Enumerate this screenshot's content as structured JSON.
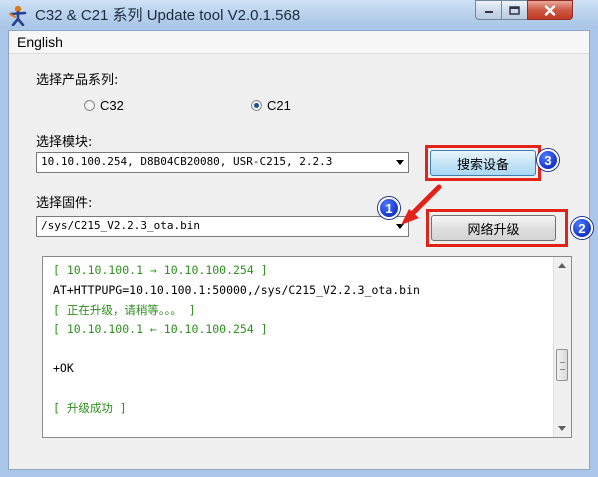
{
  "window": {
    "title": "C32 & C21 系列 Update tool V2.0.1.568",
    "icons": {
      "app": "app-person-icon",
      "minimize": "minimize-icon",
      "maximize": "maximize-icon",
      "close": "close-icon"
    }
  },
  "menubar": {
    "items": [
      "English"
    ]
  },
  "product": {
    "label": "选择产品系列:",
    "options": [
      {
        "label": "C32",
        "checked": false
      },
      {
        "label": "C21",
        "checked": true
      }
    ]
  },
  "module": {
    "label": "选择模块:",
    "selected": "10.10.100.254, D8B04CB20080, USR-C215, 2.2.3",
    "search_button": "搜索设备"
  },
  "firmware": {
    "label": "选择固件:",
    "selected": "/sys/C215_V2.2.3_ota.bin",
    "upgrade_button": "网络升级"
  },
  "annotations": {
    "badges": [
      "1",
      "2",
      "3"
    ],
    "highlight_color": "#e2231a",
    "badge_color": "#1636c8"
  },
  "log": {
    "lines": [
      {
        "text": "[ 10.10.100.1 → 10.10.100.254 ]",
        "color": "green"
      },
      {
        "text": "AT+HTTPUPG=10.10.100.1:50000,/sys/C215_V2.2.3_ota.bin",
        "color": "black"
      },
      {
        "text": "[ 正在升级，请稍等。。。 ]",
        "color": "green"
      },
      {
        "text": "[ 10.10.100.1 ← 10.10.100.254 ]",
        "color": "green"
      },
      {
        "text": "",
        "color": "black"
      },
      {
        "text": "+OK",
        "color": "black"
      },
      {
        "text": "",
        "color": "black"
      },
      {
        "text": "[ 升级成功 ]",
        "color": "green"
      },
      {
        "text": "",
        "color": "black"
      },
      {
        "text": "-                               -",
        "color": "green"
      }
    ]
  }
}
